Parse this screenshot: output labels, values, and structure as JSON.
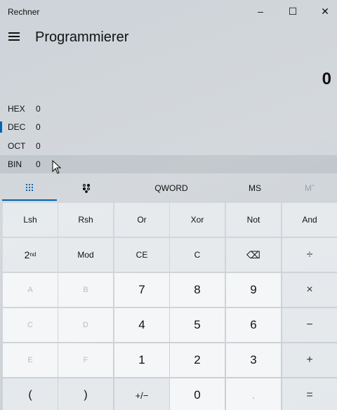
{
  "window": {
    "title": "Rechner",
    "minimize_glyph": "–",
    "maximize_glyph": "☐",
    "close_glyph": "✕"
  },
  "header": {
    "mode_title": "Programmierer"
  },
  "display": {
    "value": "0"
  },
  "radix": [
    {
      "label": "HEX",
      "value": "0"
    },
    {
      "label": "DEC",
      "value": "0"
    },
    {
      "label": "OCT",
      "value": "0"
    },
    {
      "label": "BIN",
      "value": "0"
    }
  ],
  "mode_bar": {
    "word_size": "QWORD",
    "memory_store": "MS",
    "memory_view": "Mˇ"
  },
  "keys": {
    "lsh": "Lsh",
    "rsh": "Rsh",
    "or": "Or",
    "xor": "Xor",
    "not": "Not",
    "and": "And",
    "second_base": "2",
    "second_sup": "nd",
    "mod": "Mod",
    "ce": "CE",
    "c": "C",
    "backspace": "⌫",
    "divide": "÷",
    "a": "A",
    "b": "B",
    "seven": "7",
    "eight": "8",
    "nine": "9",
    "multiply": "×",
    "c_hex": "C",
    "d": "D",
    "four": "4",
    "five": "5",
    "six": "6",
    "minus": "−",
    "e": "E",
    "f": "F",
    "one": "1",
    "two": "2",
    "three": "3",
    "plus": "+",
    "lparen": "(",
    "rparen": ")",
    "negate": "+/−",
    "zero": "0",
    "decimal": ".",
    "equals": "="
  },
  "colors": {
    "accent": "#0063b1"
  }
}
